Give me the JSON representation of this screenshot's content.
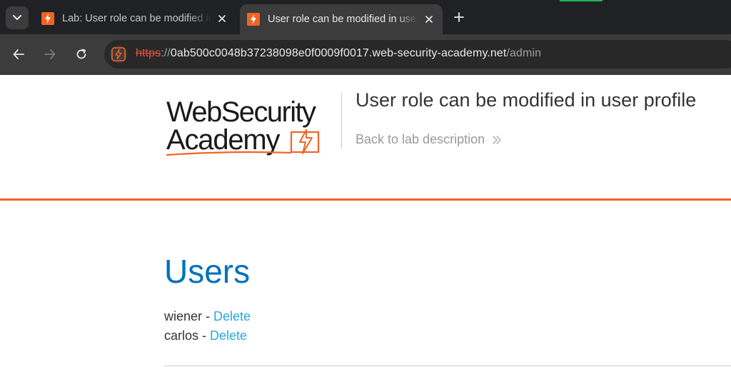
{
  "browser": {
    "tabs": [
      {
        "title": "Lab: User role can be modified in user profile",
        "active": false
      },
      {
        "title": "User role can be modified in user profile",
        "active": true
      }
    ],
    "url": {
      "scheme": "https",
      "separator": "://",
      "host": "0ab500c0048b37238098e0f0009f0017.web-security-academy.net",
      "path": "/admin"
    },
    "colors": {
      "favicon": "#f26322",
      "insecure_scheme": "#e0533f"
    }
  },
  "header": {
    "logo": {
      "line1": "WebSecurity",
      "line2": "Academy"
    },
    "lab_title": "User role can be modified in user profile",
    "back_link": "Back to lab description"
  },
  "main": {
    "heading": "Users",
    "users": [
      {
        "name": "wiener",
        "separator": " - ",
        "action": "Delete"
      },
      {
        "name": "carlos",
        "separator": " - ",
        "action": "Delete"
      }
    ]
  },
  "colors": {
    "accent": "#f26322",
    "heading": "#0071bc",
    "link": "#29a8e0"
  }
}
